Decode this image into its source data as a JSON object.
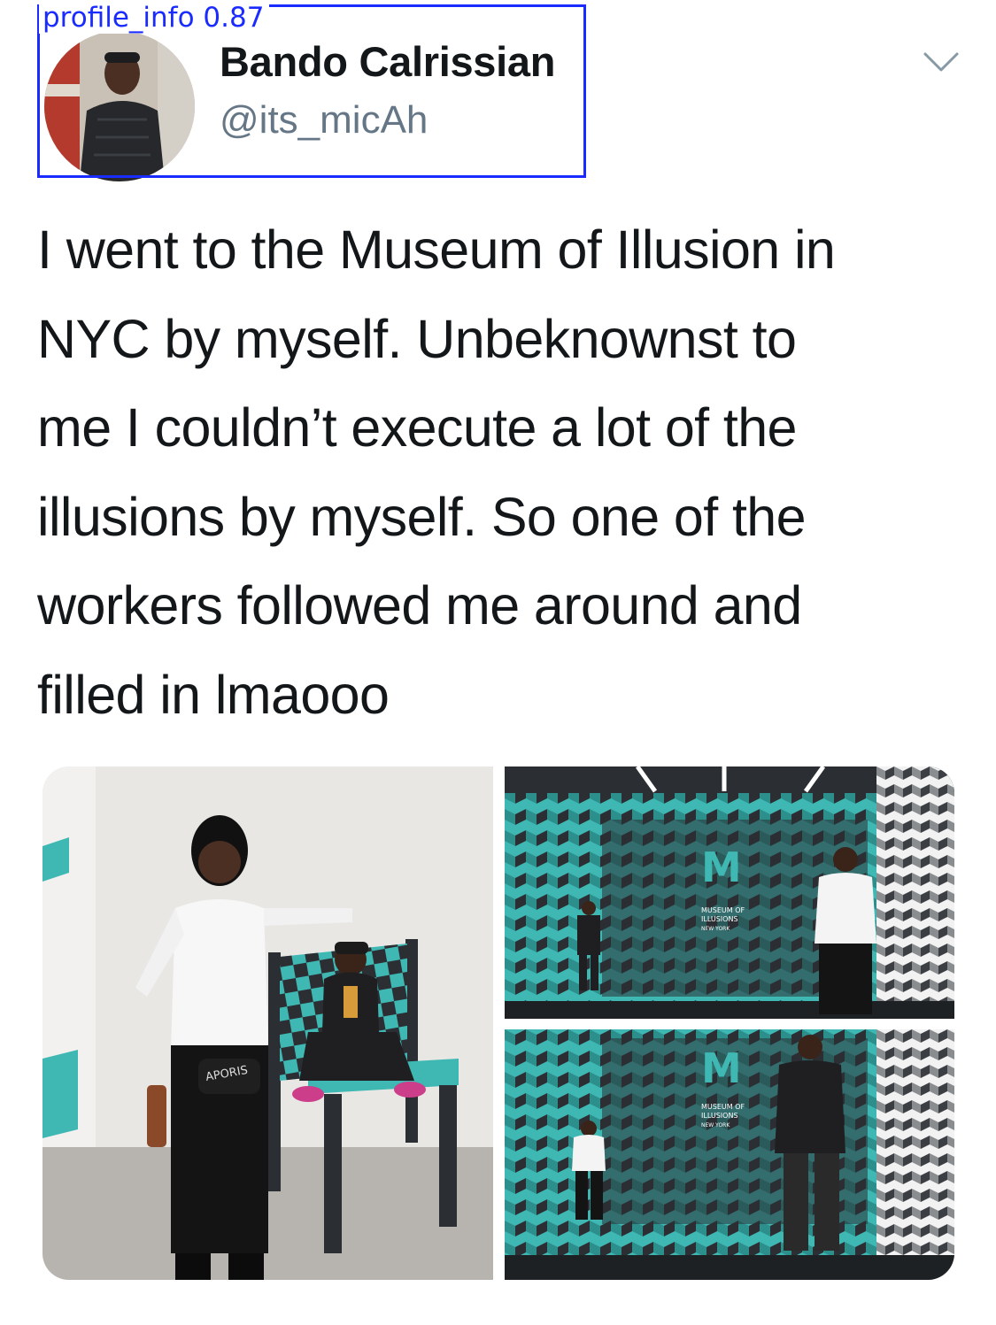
{
  "detection": {
    "label": "profile_info 0.87",
    "color": "#1a2bff"
  },
  "user": {
    "display_name": "Bando Calrissian",
    "handle": "@its_micAh",
    "avatar_icon": "user-avatar"
  },
  "menu": {
    "icon": "chevron-down-icon"
  },
  "tweet": {
    "lines": [
      "I went to the Museum of Illusion in",
      "NYC by myself. Unbeknownst to",
      "me I couldn’t execute a lot of the",
      "illusions by myself. So one of the",
      "workers followed me around and",
      "filled in lmaooo"
    ]
  },
  "media": {
    "count": 3,
    "photos": [
      {
        "name": "photo-chair-illusion",
        "bag_text": "APORIS"
      },
      {
        "name": "photo-ames-room-1",
        "wall_text": [
          "MUSEUM OF",
          "ILLUSIONS",
          "NEW YORK"
        ]
      },
      {
        "name": "photo-ames-room-2",
        "wall_text": [
          "MUSEUM OF",
          "ILLUSIONS",
          "NEW YORK"
        ]
      }
    ],
    "colors": {
      "teal": "#3fb8b4",
      "dark": "#2b2f33"
    }
  }
}
